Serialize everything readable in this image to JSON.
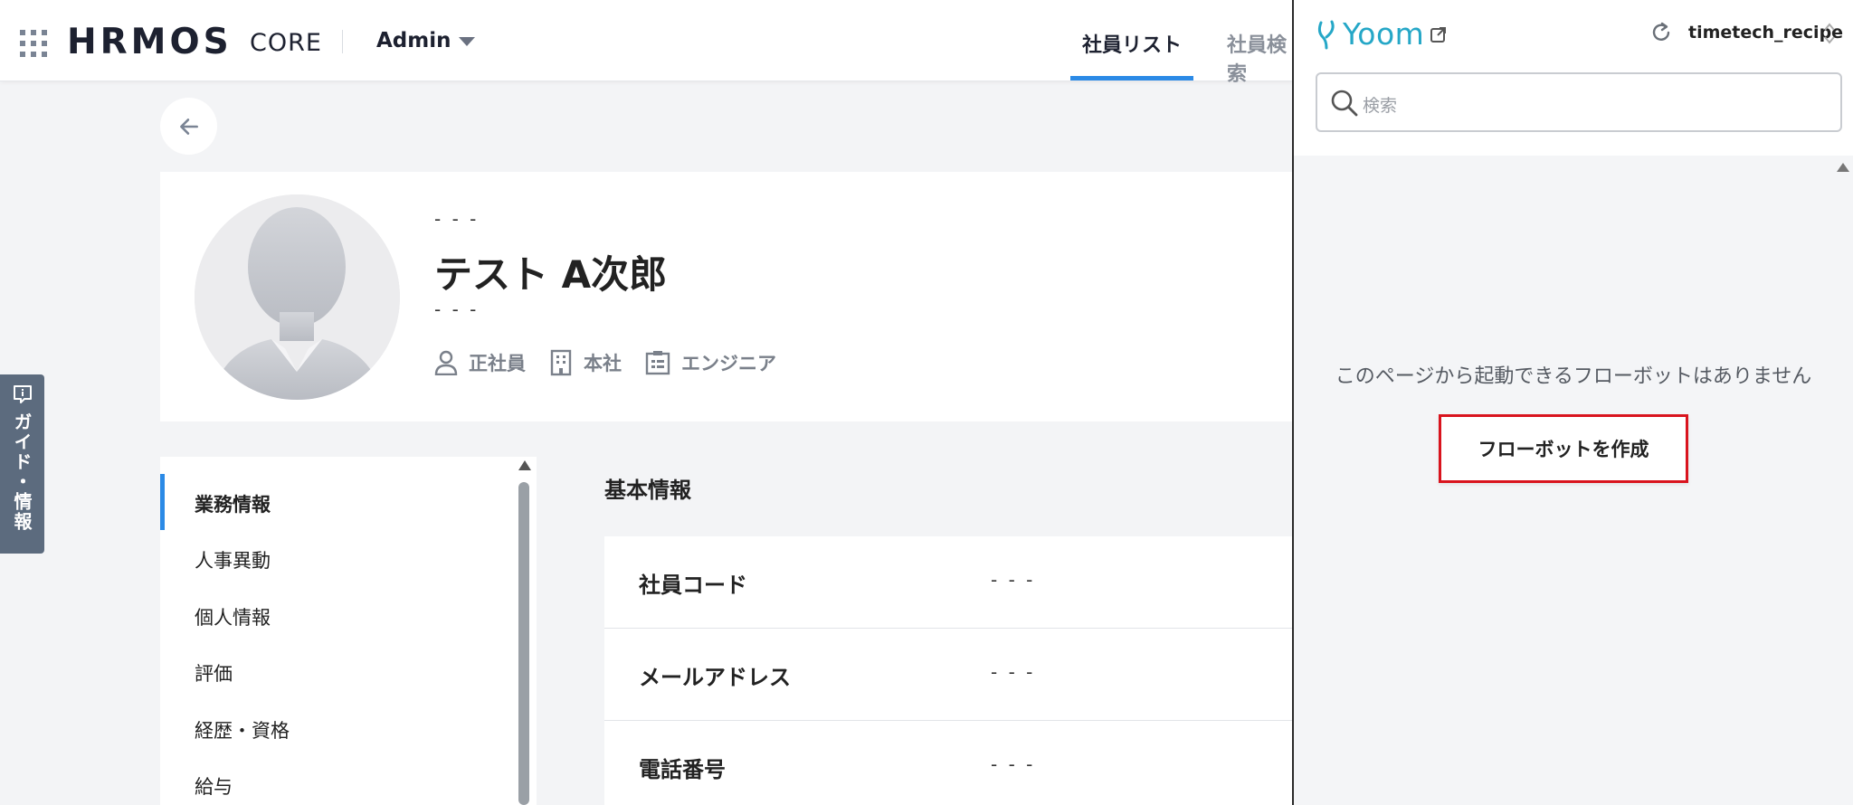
{
  "header": {
    "logo": "HRMOS",
    "product": "CORE",
    "role_select": "Admin",
    "tabs": [
      {
        "label": "社員リスト"
      },
      {
        "label": "社員検索"
      }
    ]
  },
  "profile": {
    "kana": "- - -",
    "name": "テスト A次郎",
    "sub": "- - -",
    "employment_type": "正社員",
    "office": "本社",
    "job": "エンジニア"
  },
  "guide_tab": {
    "label": "ガイド・情報"
  },
  "side_menu": {
    "items": [
      {
        "label": "業務情報"
      },
      {
        "label": "人事異動"
      },
      {
        "label": "個人情報"
      },
      {
        "label": "評価"
      },
      {
        "label": "経歴・資格"
      },
      {
        "label": "給与"
      }
    ]
  },
  "basic_info": {
    "title": "基本情報",
    "rows": [
      {
        "label": "社員コード",
        "value": "- - -"
      },
      {
        "label": "メールアドレス",
        "value": "- - -"
      },
      {
        "label": "電話番号",
        "value": "- - -"
      }
    ]
  },
  "yoom": {
    "logo": "Yoom",
    "account": "timetech_recipe",
    "search_placeholder": "検索",
    "empty_message": "このページから起動できるフローボットはありません",
    "create_button": "フローボットを作成"
  },
  "colors": {
    "accent_blue": "#2b8ae6",
    "yoom_teal": "#25a7c7",
    "highlight_red": "#d9141e",
    "guide_tab_bg": "#5c6b7e"
  }
}
